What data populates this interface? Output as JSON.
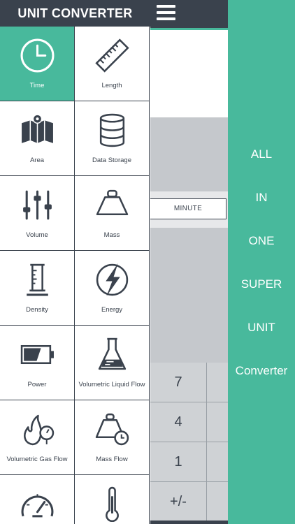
{
  "drawer": {
    "title": "UNIT CONVERTER",
    "tiles": [
      {
        "label": "Time",
        "icon": "clock-icon",
        "active": true
      },
      {
        "label": "Length",
        "icon": "ruler-icon",
        "active": false
      },
      {
        "label": "Area",
        "icon": "map-icon",
        "active": false
      },
      {
        "label": "Data Storage",
        "icon": "database-icon",
        "active": false
      },
      {
        "label": "Volume",
        "icon": "sliders-icon",
        "active": false
      },
      {
        "label": "Mass",
        "icon": "weight-icon",
        "active": false
      },
      {
        "label": "Density",
        "icon": "graduated-cylinder-icon",
        "active": false
      },
      {
        "label": "Energy",
        "icon": "lightning-icon",
        "active": false
      },
      {
        "label": "Power",
        "icon": "battery-icon",
        "active": false
      },
      {
        "label": "Volumetric Liquid Flow",
        "icon": "flask-icon",
        "active": false
      },
      {
        "label": "Volumetric Gas Flow",
        "icon": "gas-flame-gauge-icon",
        "active": false
      },
      {
        "label": "Mass Flow",
        "icon": "weight-clock-icon",
        "active": false
      },
      {
        "label": "",
        "icon": "speedometer-icon",
        "active": false
      },
      {
        "label": "",
        "icon": "thermometer-icon",
        "active": false
      }
    ]
  },
  "converter": {
    "unit_selected": "MINUTE",
    "keypad": [
      "7",
      "4",
      "1",
      "+/-"
    ]
  },
  "promo": {
    "words": [
      "ALL",
      "IN",
      "ONE",
      "SUPER",
      "UNIT",
      "Converter"
    ]
  },
  "colors": {
    "accent": "#48b99c",
    "dark": "#3a424d",
    "panel_gray": "#c5c8cc"
  }
}
